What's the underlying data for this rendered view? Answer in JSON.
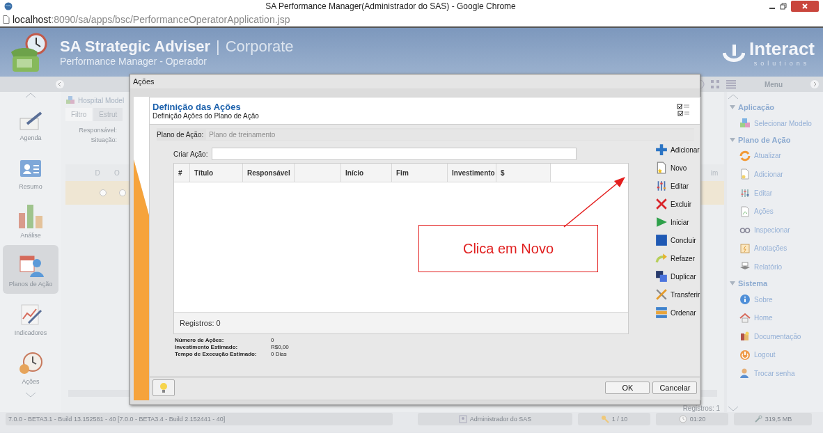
{
  "browser": {
    "title": "SA Performance Manager(Administrador do SAS) - Google Chrome",
    "url_host": "localhost",
    "url_path": ":8090/sa/apps/bsc/PerformanceOperatorApplication.jsp"
  },
  "app_header": {
    "product": "SA Strategic Adviser",
    "separator": "|",
    "edition": "Corporate",
    "subtitle": "Performance Manager - Operador",
    "brand": "Interact",
    "brand_tagline": "solutions"
  },
  "toolbar": {
    "menu_label": "Menu"
  },
  "nav": [
    {
      "label": "Agenda",
      "selected": false
    },
    {
      "label": "Resumo",
      "selected": false
    },
    {
      "label": "Análise",
      "selected": false
    },
    {
      "label": "Planos de Ação",
      "selected": true
    },
    {
      "label": "Indicadores",
      "selected": false
    },
    {
      "label": "Ações",
      "selected": false
    }
  ],
  "center_panel": {
    "model": "Hospital Model",
    "tabs": [
      {
        "label": "Filtro",
        "selected": true
      },
      {
        "label": "Estrut",
        "selected": false
      }
    ],
    "filters": [
      "Responsável:",
      "Situação:"
    ],
    "columns": [
      "D",
      "O"
    ],
    "column_end": "im",
    "footer": "Registros: 1"
  },
  "menu": [
    {
      "title": "Aplicação",
      "expanded": true,
      "items": [
        "Selecionar Modelo"
      ]
    },
    {
      "title": "Plano de Ação",
      "expanded": true,
      "items": [
        "Atualizar",
        "Adicionar",
        "Editar",
        "Ações",
        "Inspecionar",
        "Anotações",
        "Relatório"
      ]
    },
    {
      "title": "Sistema",
      "expanded": true,
      "items": [
        "Sobre",
        "Home",
        "Documentação",
        "Logout",
        "Trocar senha"
      ]
    }
  ],
  "status_bar": {
    "version": "7.0.0 - BETA3.1 - Build 13.152581 - 40 [7.0.0 - BETA3.4 - Build 2.152441 - 40]",
    "user": "Administrador do SAS",
    "page": "1 / 10",
    "time": "01:20",
    "memory": "319,5 MB"
  },
  "dialog": {
    "title": "Ações",
    "heading": "Definição das Ações",
    "subheading": "Definição Ações do Plano de Ação",
    "plan_label": "Plano de Ação:",
    "plan_value": "Plano de treinamento",
    "create_label": "Criar Ação:",
    "columns": [
      "#",
      "Título",
      "Responsável",
      "",
      "Início",
      "Fim",
      "Investimento",
      "$"
    ],
    "records": "Registros: 0",
    "summary": [
      {
        "label": "Número de Ações:",
        "value": "0"
      },
      {
        "label": "Investimento Estimado:",
        "value": "R$0,00"
      },
      {
        "label": "Tempo de Execução Estimado:",
        "value": "0 Dias"
      }
    ],
    "actions": [
      "Adicionar",
      "Novo",
      "Editar",
      "Excluir",
      "Iniciar",
      "Concluir",
      "Refazer",
      "Duplicar",
      "Transferir",
      "Ordenar"
    ],
    "buttons": [
      "OK",
      "Cancelar"
    ]
  },
  "annotation": {
    "text": "Clica em Novo"
  }
}
